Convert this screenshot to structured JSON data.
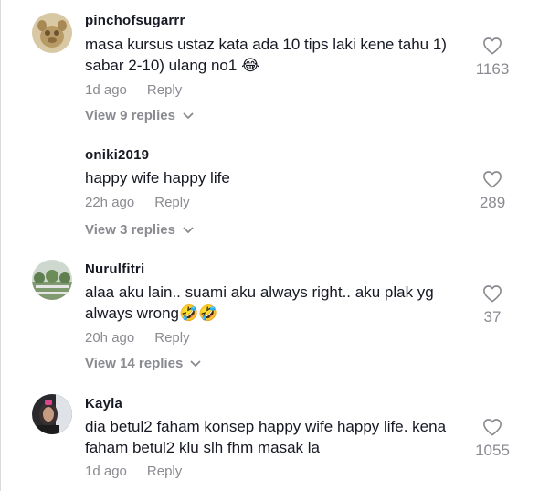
{
  "comments": [
    {
      "username": "pinchofsugarrr",
      "text": "masa kursus ustaz kata ada 10 tips laki kene tahu 1) sabar 2-10) ulang no1",
      "emoji": "😂",
      "time": "1d ago",
      "reply_label": "Reply",
      "view_replies": "View 9 replies",
      "likes": "1163"
    },
    {
      "username": "oniki2019",
      "text": "happy wife happy life",
      "time": "22h ago",
      "reply_label": "Reply",
      "view_replies": "View 3 replies",
      "likes": "289"
    },
    {
      "username": "Nurulfitri",
      "text": "alaa aku lain.. suami aku always right.. aku plak yg always wrong",
      "emoji": "🤣🤣",
      "time": "20h ago",
      "reply_label": "Reply",
      "view_replies": "View 14 replies",
      "likes": "37"
    },
    {
      "username": "Kayla",
      "text": "dia betul2 faham konsep happy wife happy life. kena faham betul2 klu slh fhm masak la",
      "time": "1d ago",
      "reply_label": "Reply",
      "likes": "1055"
    }
  ],
  "icons": {
    "like": "heart-outline-icon",
    "expand": "chevron-down-icon"
  },
  "colors": {
    "text": "#161823",
    "secondary": "#8a8b91"
  }
}
